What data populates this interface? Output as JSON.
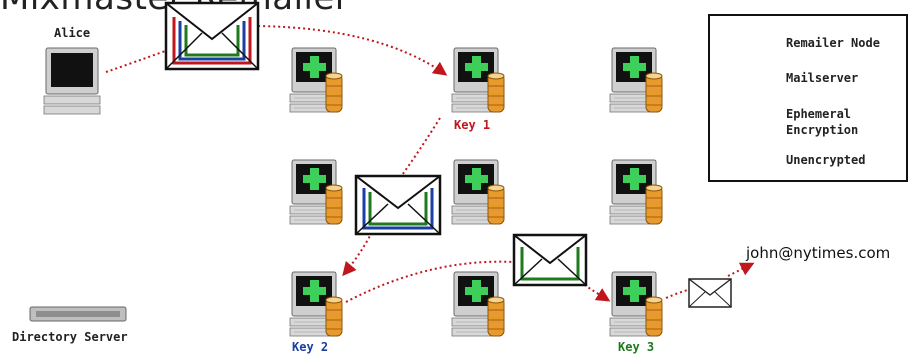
{
  "title": "Mixmaster Remailer",
  "alice_label": "Alice",
  "directory_label": "Directory Server",
  "keys": {
    "key1": "Key 1",
    "key2": "Key 2",
    "key3": "Key 3"
  },
  "destination": "john@nytimes.com",
  "legend": {
    "remailer_node": "Remailer Node",
    "mailserver": "Mailserver",
    "ephemeral_line1": "Ephemeral",
    "ephemeral_line2": "Encryption",
    "unencrypted": "Unencrypted"
  },
  "colors": {
    "key1": "#c0161c",
    "key2": "#1a3fa0",
    "key3": "#1d7a1d",
    "ephemeral_arrow": "#22b34a",
    "unencrypted_arrow": "#c0161c"
  },
  "icons": {
    "computer": "computer-icon",
    "remailer": "remailer-node-icon",
    "mailserver": "mailserver-icon",
    "envelope": "envelope-icon",
    "server": "directory-server-icon"
  }
}
